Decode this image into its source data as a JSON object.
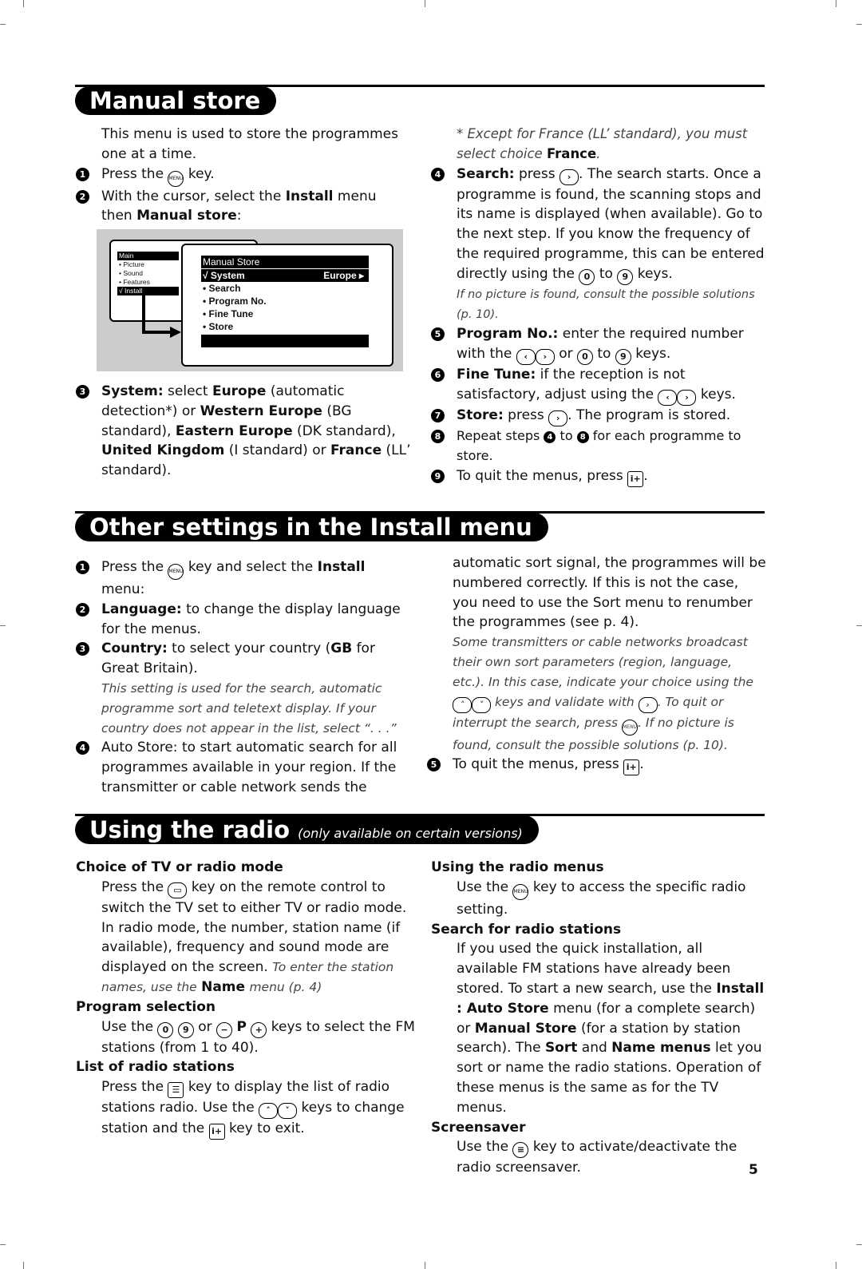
{
  "sections": {
    "manual_store": {
      "title": "Manual store",
      "intro": "This menu is used to store the programmes one at a time.",
      "step1": {
        "pre": "Press the",
        "key": "MENU",
        "post": "key."
      },
      "step2": {
        "pre": "With the cursor, select the",
        "b1": "Install",
        "mid": "menu then",
        "b2": "Manual store",
        "post": ":"
      },
      "screen": {
        "main_menu": {
          "title": "Main",
          "items": [
            "• Picture",
            "• Sound",
            "• Features"
          ],
          "selected": "√ Install"
        },
        "submenu": {
          "title": "Manual Store",
          "selected_label": "√ System",
          "selected_value": "Europe ▸",
          "items": [
            "• Search",
            "• Program No.",
            "• Fine Tune",
            "• Store"
          ]
        }
      },
      "step3": {
        "b1": "System:",
        "t1": "select",
        "b2": "Europe",
        "t2": "(automatic detection*) or",
        "b3": "Western Europe",
        "t3": "(BG standard),",
        "b4": "Eastern Europe",
        "t4": "(DK standard),",
        "b5": "United Kingdom",
        "t5": "(I standard) or",
        "b6": "France",
        "t6": "(LL’ standard)."
      },
      "footnote": {
        "text": "* Except for France (LL’ standard), you must select choice",
        "b": "France",
        "post": "."
      },
      "step4": {
        "b": "Search:",
        "t1": "press",
        "t2": ". The search starts. Once a programme is found, the scanning stops and its name is displayed (when available). Go to the next step. If you know the frequency of the required programme, this can be entered directly using the",
        "k0": "0",
        "to": "to",
        "k9": "9",
        "t3": "keys.",
        "note": "If no picture is found, consult the possible solutions (p. 10)."
      },
      "step5": {
        "b": "Program No.:",
        "t1": "enter the required number with the",
        "or": "or",
        "k0": "0",
        "to": "to",
        "k9": "9",
        "t2": "keys."
      },
      "step6": {
        "b": "Fine Tune:",
        "t1": "if the reception is not satisfactory, adjust using the",
        "t2": "keys."
      },
      "step7": {
        "b": "Store:",
        "t1": "press",
        "t2": ". The program is stored."
      },
      "step8": {
        "t1": "Repeat steps",
        "n1": "4",
        "to": "to",
        "n2": "8",
        "t2": "for each programme to store."
      },
      "step9": {
        "t1": "To quit the menus, press",
        "t2": "."
      }
    },
    "other_settings": {
      "title": "Other settings in the Install menu",
      "step1": {
        "t1": "Press the",
        "t2": "key and select the",
        "b": "Install",
        "t3": "menu:"
      },
      "step2": {
        "b": "Language:",
        "t": "to change the display language for the menus."
      },
      "step3": {
        "b": "Country:",
        "t1": "to select your country (",
        "b2": "GB",
        "t2": "for Great Britain).",
        "note": "This setting is used for the search, automatic programme sort and teletext display. If your country does not appear in the list, select “. . .”"
      },
      "step4": {
        "t": "Auto Store: to start automatic search for all programmes available in your region. If the transmitter or cable network sends the automatic sort signal, the programmes will be numbered correctly. If this is not the case, you need to use the Sort menu to renumber the programmes (see p. 4).",
        "note1": "Some transmitters or cable networks broadcast their own sort parameters (region, language, etc.). In this case, indicate your choice using the",
        "note2": "keys and validate with",
        "note3": ". To quit or interrupt the search, press",
        "note4": ". If no picture is found, consult the possible solutions (p. 10)."
      },
      "step5": {
        "t1": "To quit the menus, press",
        "t2": "."
      }
    },
    "radio": {
      "title": "Using the radio",
      "subtitle": "(only available on certain versions)",
      "choice": {
        "head": "Choice of TV or radio mode",
        "t1": "Press the",
        "t2": "key on the remote control to switch the TV set to either TV or radio mode. In radio mode, the number, station name (if available), frequency and sound mode are displayed on the screen.",
        "note1": "To enter the station names, use the",
        "nb": "Name",
        "note2": "menu (p. 4)"
      },
      "program": {
        "head": "Program selection",
        "t1": "Use the",
        "k0": "0",
        "k9": "9",
        "or": "or",
        "minus": "−",
        "p": "P",
        "plus": "+",
        "t2": "keys to select the FM stations (from 1 to 40)."
      },
      "list": {
        "head": "List of radio stations",
        "t1": "Press the",
        "t2": "key to display the list of radio stations radio. Use the",
        "t3": "keys to change station and the",
        "t4": "key to exit."
      },
      "menus": {
        "head": "Using the radio menus",
        "t1": "Use the",
        "t2": "key to access the specific radio setting."
      },
      "search": {
        "head": "Search for radio stations",
        "t1": "If you used the quick installation, all available FM stations have already been stored. To start a new search, use the",
        "b1": "Install : Auto Store",
        "t2": "menu (for a complete search) or",
        "b2": "Manual Store",
        "t3": "(for a station by station search). The",
        "b3": "Sort",
        "t4": "and",
        "b4": "Name menus",
        "t5": "let you sort or name the radio stations. Operation of these menus is the same as for the TV menus."
      },
      "screensaver": {
        "head": "Screensaver",
        "t1": "Use the",
        "t2": "key to activate/deactivate the radio screensaver."
      }
    }
  },
  "keys": {
    "menu": "MENU",
    "right": "›",
    "left": "‹",
    "up": "˄",
    "down": "˅",
    "info": "i+",
    "tvradio": "▭",
    "list": "☰",
    "screensaver": "≡"
  },
  "step_numbers": [
    "1",
    "2",
    "3",
    "4",
    "5",
    "6",
    "7",
    "8",
    "9"
  ],
  "page_number": "5"
}
